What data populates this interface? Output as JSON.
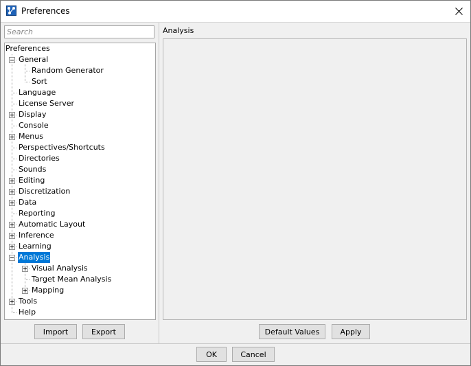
{
  "window": {
    "title": "Preferences"
  },
  "search": {
    "placeholder": "Search",
    "value": ""
  },
  "tree": {
    "root": "Preferences",
    "nodes": [
      {
        "label": "General",
        "toggle": "minus"
      },
      {
        "label": "Random Generator",
        "toggle": ""
      },
      {
        "label": "Sort",
        "toggle": ""
      },
      {
        "label": "Language",
        "toggle": ""
      },
      {
        "label": "License Server",
        "toggle": ""
      },
      {
        "label": "Display",
        "toggle": "plus"
      },
      {
        "label": "Console",
        "toggle": ""
      },
      {
        "label": "Menus",
        "toggle": "plus"
      },
      {
        "label": "Perspectives/Shortcuts",
        "toggle": ""
      },
      {
        "label": "Directories",
        "toggle": ""
      },
      {
        "label": "Sounds",
        "toggle": ""
      },
      {
        "label": "Editing",
        "toggle": "plus"
      },
      {
        "label": "Discretization",
        "toggle": "plus"
      },
      {
        "label": "Data",
        "toggle": "plus"
      },
      {
        "label": "Reporting",
        "toggle": ""
      },
      {
        "label": "Automatic Layout",
        "toggle": "plus"
      },
      {
        "label": "Inference",
        "toggle": "plus"
      },
      {
        "label": "Learning",
        "toggle": "plus"
      },
      {
        "label": "Analysis",
        "toggle": "minus",
        "selected": true
      },
      {
        "label": "Visual Analysis",
        "toggle": "plus"
      },
      {
        "label": "Target Mean Analysis",
        "toggle": ""
      },
      {
        "label": "Mapping",
        "toggle": "plus"
      },
      {
        "label": "Tools",
        "toggle": "plus"
      },
      {
        "label": "Help",
        "toggle": ""
      }
    ]
  },
  "left_buttons": {
    "import": "Import",
    "export": "Export"
  },
  "right_panel": {
    "title": "Analysis"
  },
  "right_buttons": {
    "default_values": "Default Values",
    "apply": "Apply"
  },
  "dialog_buttons": {
    "ok": "OK",
    "cancel": "Cancel"
  },
  "colors": {
    "selection": "#0078d7",
    "app_icon": "#1e62b8"
  }
}
